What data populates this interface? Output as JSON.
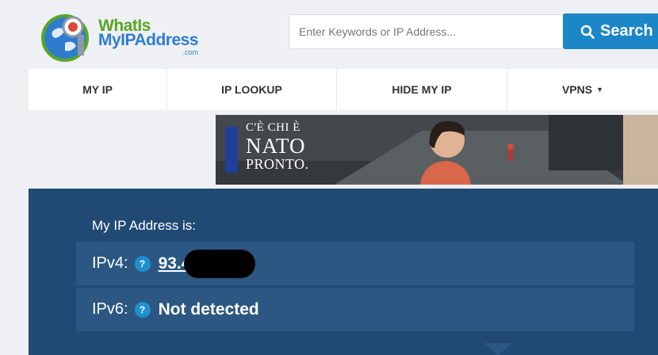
{
  "header": {
    "logo": {
      "line1": "WhatIs",
      "line2": "MyIPAddress",
      "suffix": ".com"
    },
    "search": {
      "placeholder": "Enter Keywords or IP Address...",
      "button_label": "Search"
    }
  },
  "nav": {
    "items": [
      {
        "label": "MY IP"
      },
      {
        "label": "IP LOOKUP"
      },
      {
        "label": "HIDE MY IP"
      },
      {
        "label": "VPNS",
        "has_dropdown": true
      }
    ]
  },
  "ad": {
    "line1": "C'È CHI È",
    "line2": "NATO",
    "line3": "PRONTO."
  },
  "main": {
    "label": "My IP Address is:",
    "ipv4": {
      "key": "IPv4:",
      "help": "?",
      "value": "93.4"
    },
    "ipv6": {
      "key": "IPv6:",
      "help": "?",
      "value": "Not detected"
    }
  },
  "colors": {
    "brand_blue": "#1b87c7",
    "panel_bg": "#204a74",
    "row_bg": "#2b5782",
    "logo_green": "#5aa624",
    "logo_blue": "#2f7ccf"
  }
}
